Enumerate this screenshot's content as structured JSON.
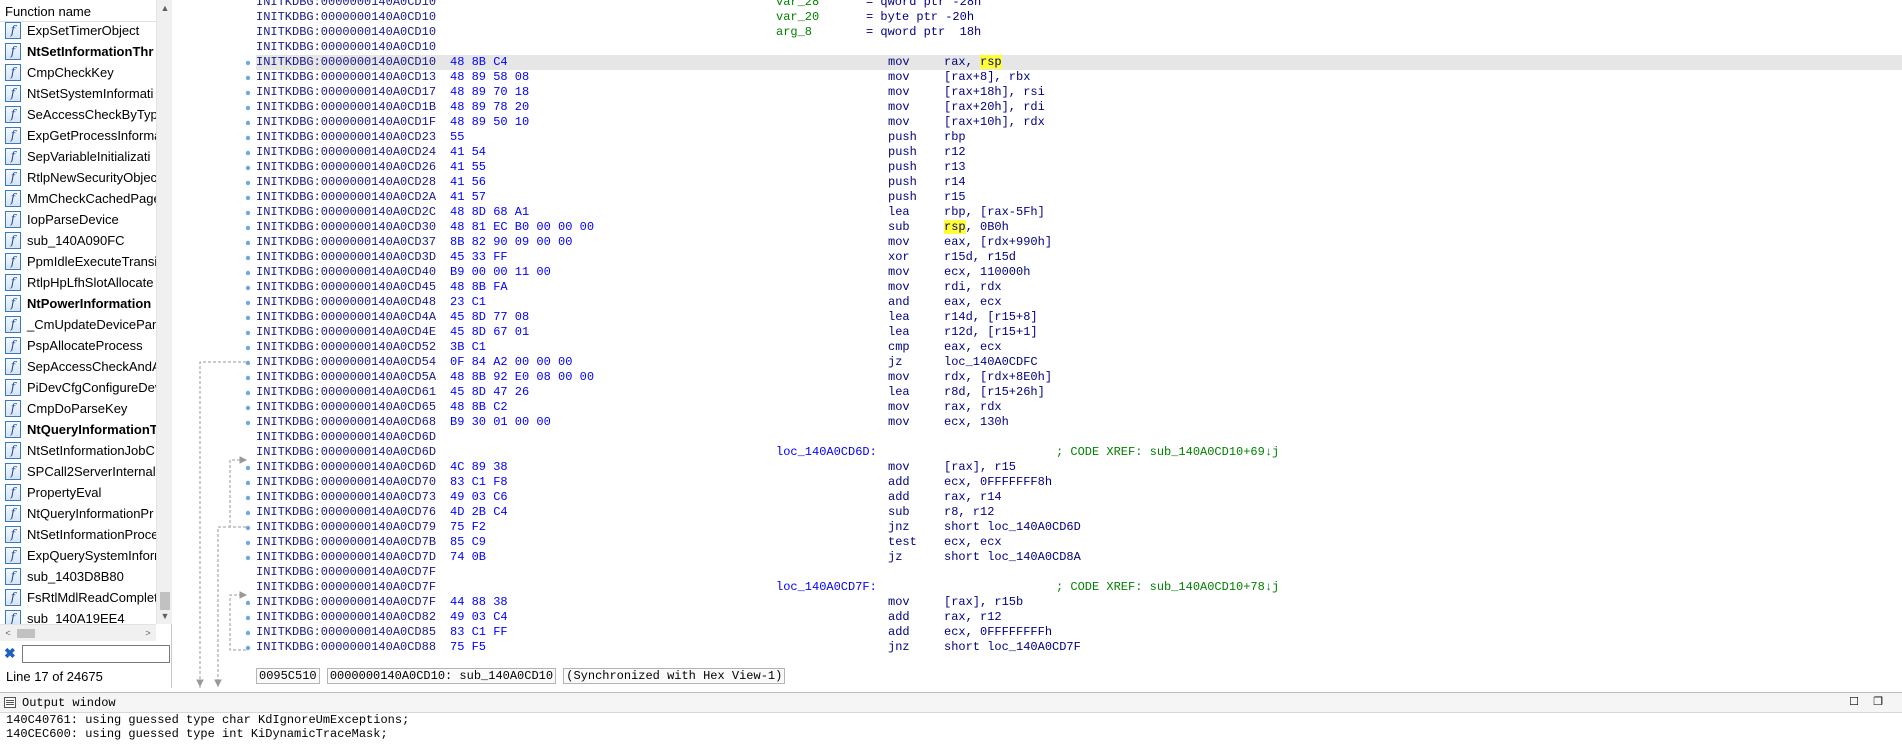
{
  "function_list": {
    "header": "Function name",
    "icon": "function-f-icon",
    "items": [
      {
        "name": "ExpSetTimerObject",
        "bold": false
      },
      {
        "name": "NtSetInformationThr",
        "bold": true
      },
      {
        "name": "CmpCheckKey",
        "bold": false
      },
      {
        "name": "NtSetSystemInformati",
        "bold": false
      },
      {
        "name": "SeAccessCheckByType",
        "bold": false
      },
      {
        "name": "ExpGetProcessInforma",
        "bold": false
      },
      {
        "name": "SepVariableInitializati",
        "bold": false
      },
      {
        "name": "RtlpNewSecurityObjec",
        "bold": false
      },
      {
        "name": "MmCheckCachedPage",
        "bold": false
      },
      {
        "name": "IopParseDevice",
        "bold": false
      },
      {
        "name": "sub_140A090FC",
        "bold": false
      },
      {
        "name": "PpmIdleExecuteTransit",
        "bold": false
      },
      {
        "name": "RtlpHpLfhSlotAllocate",
        "bold": false
      },
      {
        "name": "NtPowerInformation",
        "bold": true
      },
      {
        "name": "_CmUpdateDevicePane",
        "bold": false
      },
      {
        "name": "PspAllocateProcess",
        "bold": false
      },
      {
        "name": "SepAccessCheckAndAu",
        "bold": false
      },
      {
        "name": "PiDevCfgConfigureDev",
        "bold": false
      },
      {
        "name": "CmpDoParseKey",
        "bold": false
      },
      {
        "name": "NtQueryInformationT",
        "bold": true
      },
      {
        "name": "NtSetInformationJobC",
        "bold": false
      },
      {
        "name": "SPCall2ServerInternal",
        "bold": false
      },
      {
        "name": "PropertyEval",
        "bold": false
      },
      {
        "name": "NtQueryInformationPr",
        "bold": false
      },
      {
        "name": "NtSetInformationProce",
        "bold": false
      },
      {
        "name": "ExpQuerySystemInforr",
        "bold": false
      },
      {
        "name": "sub_1403D8B80",
        "bold": false
      },
      {
        "name": "FsRtlMdlReadComplet",
        "bold": false
      },
      {
        "name": "sub_140A19EE4",
        "bold": false
      }
    ],
    "filter_value": "",
    "line_status": "Line 17 of 24675"
  },
  "disassembly": {
    "lines": [
      {
        "addr": "INITKDBG:0000000140A0CD10",
        "var": "var_28",
        "ops": "= qword ptr -28h"
      },
      {
        "addr": "INITKDBG:0000000140A0CD10",
        "var": "var_20",
        "ops": "= byte ptr -20h"
      },
      {
        "addr": "INITKDBG:0000000140A0CD10",
        "var": "arg_8",
        "ops": "= qword ptr  18h"
      },
      {
        "addr": "INITKDBG:0000000140A0CD10"
      },
      {
        "addr": "INITKDBG:0000000140A0CD10",
        "bytes": "48 8B C4",
        "mnem": "mov",
        "ops_pre": "rax, ",
        "ops_hl": "rsp",
        "current": true
      },
      {
        "addr": "INITKDBG:0000000140A0CD13",
        "bytes": "48 89 58 08",
        "mnem": "mov",
        "ops": "[rax+8], rbx"
      },
      {
        "addr": "INITKDBG:0000000140A0CD17",
        "bytes": "48 89 70 18",
        "mnem": "mov",
        "ops": "[rax+18h], rsi"
      },
      {
        "addr": "INITKDBG:0000000140A0CD1B",
        "bytes": "48 89 78 20",
        "mnem": "mov",
        "ops": "[rax+20h], rdi"
      },
      {
        "addr": "INITKDBG:0000000140A0CD1F",
        "bytes": "48 89 50 10",
        "mnem": "mov",
        "ops": "[rax+10h], rdx"
      },
      {
        "addr": "INITKDBG:0000000140A0CD23",
        "bytes": "55",
        "mnem": "push",
        "ops": "rbp"
      },
      {
        "addr": "INITKDBG:0000000140A0CD24",
        "bytes": "41 54",
        "mnem": "push",
        "ops": "r12"
      },
      {
        "addr": "INITKDBG:0000000140A0CD26",
        "bytes": "41 55",
        "mnem": "push",
        "ops": "r13"
      },
      {
        "addr": "INITKDBG:0000000140A0CD28",
        "bytes": "41 56",
        "mnem": "push",
        "ops": "r14"
      },
      {
        "addr": "INITKDBG:0000000140A0CD2A",
        "bytes": "41 57",
        "mnem": "push",
        "ops": "r15"
      },
      {
        "addr": "INITKDBG:0000000140A0CD2C",
        "bytes": "48 8D 68 A1",
        "mnem": "lea",
        "ops": "rbp, [rax-5Fh]"
      },
      {
        "addr": "INITKDBG:0000000140A0CD30",
        "bytes": "48 81 EC B0 00 00 00",
        "mnem": "sub",
        "ops_hl": "rsp",
        "ops_post": ", 0B0h"
      },
      {
        "addr": "INITKDBG:0000000140A0CD37",
        "bytes": "8B 82 90 09 00 00",
        "mnem": "mov",
        "ops": "eax, [rdx+990h]"
      },
      {
        "addr": "INITKDBG:0000000140A0CD3D",
        "bytes": "45 33 FF",
        "mnem": "xor",
        "ops": "r15d, r15d"
      },
      {
        "addr": "INITKDBG:0000000140A0CD40",
        "bytes": "B9 00 00 11 00",
        "mnem": "mov",
        "ops": "ecx, 110000h"
      },
      {
        "addr": "INITKDBG:0000000140A0CD45",
        "bytes": "48 8B FA",
        "mnem": "mov",
        "ops": "rdi, rdx"
      },
      {
        "addr": "INITKDBG:0000000140A0CD48",
        "bytes": "23 C1",
        "mnem": "and",
        "ops": "eax, ecx"
      },
      {
        "addr": "INITKDBG:0000000140A0CD4A",
        "bytes": "45 8D 77 08",
        "mnem": "lea",
        "ops": "r14d, [r15+8]"
      },
      {
        "addr": "INITKDBG:0000000140A0CD4E",
        "bytes": "45 8D 67 01",
        "mnem": "lea",
        "ops": "r12d, [r15+1]"
      },
      {
        "addr": "INITKDBG:0000000140A0CD52",
        "bytes": "3B C1",
        "mnem": "cmp",
        "ops": "eax, ecx"
      },
      {
        "addr": "INITKDBG:0000000140A0CD54",
        "bytes": "0F 84 A2 00 00 00",
        "mnem": "jz",
        "ops": "loc_140A0CDFC"
      },
      {
        "addr": "INITKDBG:0000000140A0CD5A",
        "bytes": "48 8B 92 E0 08 00 00",
        "mnem": "mov",
        "ops": "rdx, [rdx+8E0h]"
      },
      {
        "addr": "INITKDBG:0000000140A0CD61",
        "bytes": "45 8D 47 26",
        "mnem": "lea",
        "ops": "r8d, [r15+26h]"
      },
      {
        "addr": "INITKDBG:0000000140A0CD65",
        "bytes": "48 8B C2",
        "mnem": "mov",
        "ops": "rax, rdx"
      },
      {
        "addr": "INITKDBG:0000000140A0CD68",
        "bytes": "B9 30 01 00 00",
        "mnem": "mov",
        "ops": "ecx, 130h"
      },
      {
        "addr": "INITKDBG:0000000140A0CD6D"
      },
      {
        "addr": "INITKDBG:0000000140A0CD6D",
        "label": "loc_140A0CD6D:",
        "comment": "; CODE XREF: sub_140A0CD10+69↓j"
      },
      {
        "addr": "INITKDBG:0000000140A0CD6D",
        "bytes": "4C 89 38",
        "mnem": "mov",
        "ops": "[rax], r15"
      },
      {
        "addr": "INITKDBG:0000000140A0CD70",
        "bytes": "83 C1 F8",
        "mnem": "add",
        "ops": "ecx, 0FFFFFFF8h"
      },
      {
        "addr": "INITKDBG:0000000140A0CD73",
        "bytes": "49 03 C6",
        "mnem": "add",
        "ops": "rax, r14"
      },
      {
        "addr": "INITKDBG:0000000140A0CD76",
        "bytes": "4D 2B C4",
        "mnem": "sub",
        "ops": "r8, r12"
      },
      {
        "addr": "INITKDBG:0000000140A0CD79",
        "bytes": "75 F2",
        "mnem": "jnz",
        "ops": "short loc_140A0CD6D"
      },
      {
        "addr": "INITKDBG:0000000140A0CD7B",
        "bytes": "85 C9",
        "mnem": "test",
        "ops": "ecx, ecx"
      },
      {
        "addr": "INITKDBG:0000000140A0CD7D",
        "bytes": "74 0B",
        "mnem": "jz",
        "ops": "short loc_140A0CD8A"
      },
      {
        "addr": "INITKDBG:0000000140A0CD7F"
      },
      {
        "addr": "INITKDBG:0000000140A0CD7F",
        "label": "loc_140A0CD7F:",
        "comment": "; CODE XREF: sub_140A0CD10+78↓j"
      },
      {
        "addr": "INITKDBG:0000000140A0CD7F",
        "bytes": "44 88 38",
        "mnem": "mov",
        "ops": "[rax], r15b"
      },
      {
        "addr": "INITKDBG:0000000140A0CD82",
        "bytes": "49 03 C4",
        "mnem": "add",
        "ops": "rax, r12"
      },
      {
        "addr": "INITKDBG:0000000140A0CD85",
        "bytes": "83 C1 FF",
        "mnem": "add",
        "ops": "ecx, 0FFFFFFFFh"
      },
      {
        "addr": "INITKDBG:0000000140A0CD88",
        "bytes": "75 F5",
        "mnem": "jnz",
        "ops": "short loc_140A0CD7F"
      }
    ],
    "status": {
      "offset": "0095C510",
      "location": "0000000140A0CD10: sub_140A0CD10",
      "sync": "(Synchronized with Hex View-1)"
    }
  },
  "output_window": {
    "title": "Output window",
    "icon": "output-window-icon",
    "lines": [
      "140C40761: using guessed type char KdIgnoreUmExceptions;",
      "140CEC600: using guessed type int KiDynamicTraceMask;"
    ]
  }
}
